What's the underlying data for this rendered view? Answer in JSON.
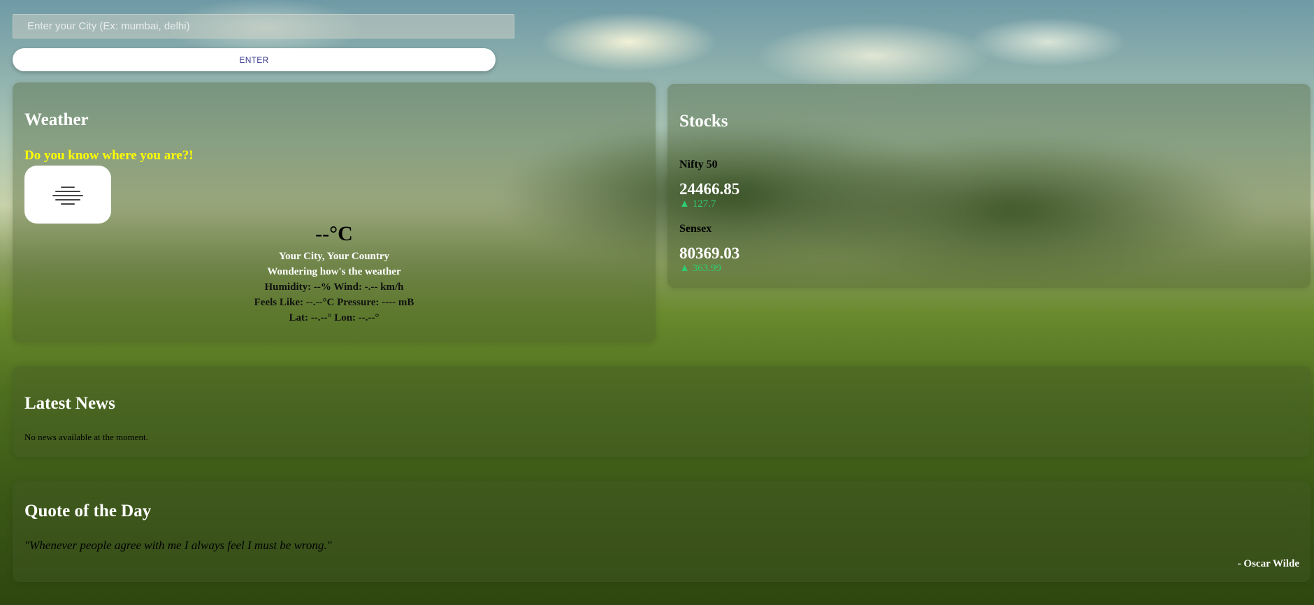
{
  "search": {
    "placeholder": "Enter your City (Ex: mumbai, delhi)",
    "value": "",
    "button_label": "ENTER"
  },
  "weather": {
    "title": "Weather",
    "tip": "Do you know where you are?!",
    "icon": "mist-icon",
    "temperature": "--°C",
    "location": "Your City, Your Country",
    "description": "Wondering how's the weather",
    "humidity_wind": "Humidity: --% Wind: -.-- km/h",
    "feels_pressure": "Feels Like: --.--°C Pressure: ---- mB",
    "lat_lon": "Lat: --.--° Lon: --.--°"
  },
  "stocks": {
    "title": "Stocks",
    "items": [
      {
        "name": "Nifty 50",
        "value": "24466.85",
        "change": "▲ 127.7"
      },
      {
        "name": "Sensex",
        "value": "80369.03",
        "change": "▲ 363.99"
      }
    ],
    "up_color": "#2ecc71"
  },
  "news": {
    "title": "Latest News",
    "empty_message": "No news available at the moment."
  },
  "quote": {
    "title": "Quote of the Day",
    "text": "\"Whenever people agree with me I always feel I must be wrong.\"",
    "author": "- Oscar Wilde"
  },
  "colors": {
    "tip_yellow": "#ffff00",
    "button_text": "#3b3b8f"
  }
}
